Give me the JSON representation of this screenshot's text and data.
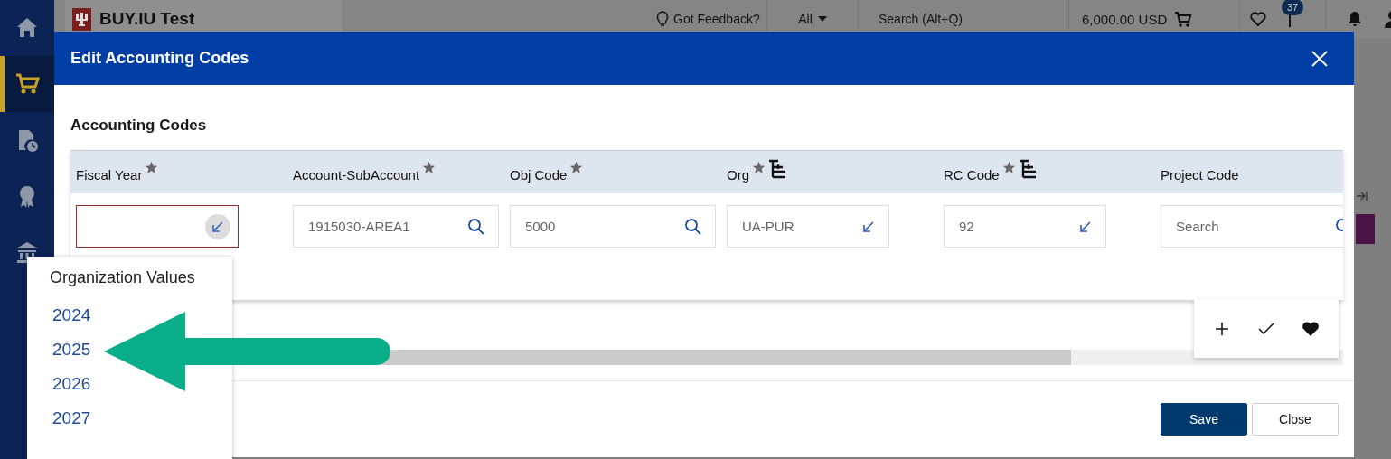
{
  "sidebar": {
    "items": [
      {
        "kind": "home",
        "selected": false
      },
      {
        "kind": "cart",
        "selected": true
      },
      {
        "kind": "document",
        "selected": false
      },
      {
        "kind": "award",
        "selected": false
      },
      {
        "kind": "bank",
        "selected": false
      }
    ]
  },
  "top_bar": {
    "title": "BUY.IU Test",
    "feedback": "Got Feedback?",
    "search_scope": "All",
    "search": {
      "placeholder": "Search (Alt+Q)"
    },
    "cart_total": "6,000.00 USD",
    "flag_count": "37"
  },
  "dialog": {
    "title": "Edit Accounting Codes",
    "section_title": "Accounting Codes",
    "columns": [
      {
        "label": "Fiscal Year",
        "required": true,
        "hierarchy": false
      },
      {
        "label": "Account-SubAccount",
        "required": true,
        "hierarchy": false
      },
      {
        "label": "Obj Code",
        "required": true,
        "hierarchy": false
      },
      {
        "label": "Org",
        "required": true,
        "hierarchy": true
      },
      {
        "label": "RC Code",
        "required": true,
        "hierarchy": true
      },
      {
        "label": "Project Code",
        "required": false,
        "hierarchy": false
      }
    ],
    "fields": [
      {
        "kind": "picker",
        "error": true,
        "open": true
      },
      {
        "kind": "search",
        "value": "1915030-AREA1",
        "error": false
      },
      {
        "kind": "search",
        "value": "5000",
        "error": false
      },
      {
        "kind": "picker",
        "value": "UA-PUR",
        "error": false,
        "open": false
      },
      {
        "kind": "picker",
        "value": "92",
        "error": false,
        "open": false
      },
      {
        "kind": "search",
        "placeholder": "Search",
        "error": false
      }
    ],
    "buttons": [
      {
        "label": "Save",
        "kind": "primary"
      },
      {
        "label": "Close",
        "kind": "secondary"
      }
    ]
  },
  "dropdown": {
    "title": "Organization Values",
    "options": [
      {
        "label": "2024",
        "selected": false
      },
      {
        "label": "2025",
        "selected": false
      },
      {
        "label": "2026",
        "selected": false
      },
      {
        "label": "2027",
        "selected": false
      }
    ]
  }
}
